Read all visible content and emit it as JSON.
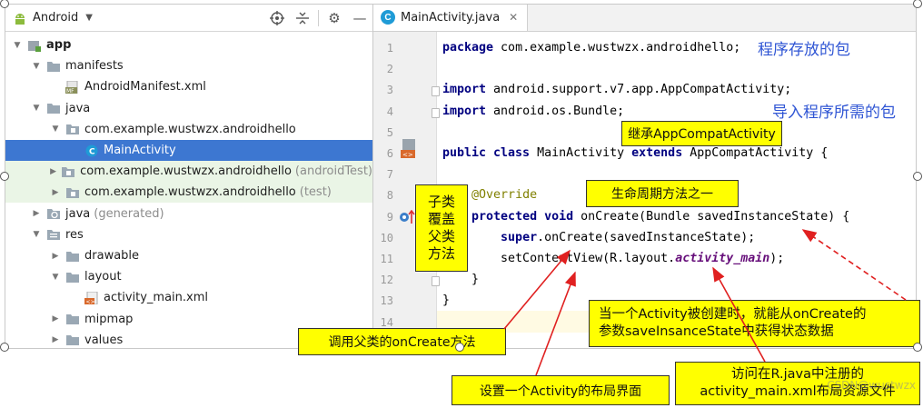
{
  "project_panel": {
    "view_mode": "Android",
    "tree": [
      {
        "label": "app",
        "indent": 0,
        "expanded": true,
        "icon": "module-icon",
        "bold": true
      },
      {
        "label": "manifests",
        "indent": 1,
        "expanded": true,
        "icon": "folder-icon"
      },
      {
        "label": "AndroidManifest.xml",
        "indent": 2,
        "icon": "manifest-file-icon"
      },
      {
        "label": "java",
        "indent": 1,
        "expanded": true,
        "icon": "folder-icon"
      },
      {
        "label": "com.example.wustwzx.androidhello",
        "indent": 2,
        "expanded": true,
        "icon": "package-icon"
      },
      {
        "label": "MainActivity",
        "indent": 3,
        "icon": "class-icon",
        "selected": true
      },
      {
        "label": "com.example.wustwzx.androidhello",
        "suffix": "(androidTest)",
        "indent": 2,
        "expanded": false,
        "icon": "package-icon",
        "test": true
      },
      {
        "label": "com.example.wustwzx.androidhello",
        "suffix": "(test)",
        "indent": 2,
        "expanded": false,
        "icon": "package-icon",
        "test": true
      },
      {
        "label": "java",
        "suffix": "(generated)",
        "indent": 1,
        "expanded": false,
        "icon": "generated-folder-icon"
      },
      {
        "label": "res",
        "indent": 1,
        "expanded": true,
        "icon": "res-folder-icon"
      },
      {
        "label": "drawable",
        "indent": 2,
        "expanded": false,
        "icon": "folder-icon"
      },
      {
        "label": "layout",
        "indent": 2,
        "expanded": true,
        "icon": "folder-icon"
      },
      {
        "label": "activity_main.xml",
        "indent": 3,
        "icon": "layout-file-icon"
      },
      {
        "label": "mipmap",
        "indent": 2,
        "expanded": false,
        "icon": "folder-icon"
      },
      {
        "label": "values",
        "indent": 2,
        "expanded": false,
        "icon": "folder-icon"
      }
    ]
  },
  "editor": {
    "tab_label": "MainActivity.java",
    "lines": [
      {
        "num": "1",
        "segs": [
          [
            "kw",
            "package"
          ],
          [
            "t",
            " com.example.wustwzx.androidhello;"
          ]
        ]
      },
      {
        "num": "2",
        "segs": []
      },
      {
        "num": "3",
        "segs": [
          [
            "kw",
            "import"
          ],
          [
            "t",
            " android.support.v7.app.AppCompatActivity;"
          ]
        ]
      },
      {
        "num": "4",
        "segs": [
          [
            "kw",
            "import"
          ],
          [
            "t",
            " android.os.Bundle;"
          ]
        ]
      },
      {
        "num": "5",
        "segs": []
      },
      {
        "num": "6",
        "segs": [
          [
            "kw",
            "public class"
          ],
          [
            "t",
            " MainActivity "
          ],
          [
            "kw",
            "extends"
          ],
          [
            "t",
            " AppCompatActivity {"
          ]
        ]
      },
      {
        "num": "7",
        "segs": []
      },
      {
        "num": "8",
        "segs": [
          [
            "t",
            "    "
          ],
          [
            "ann",
            "@Override"
          ]
        ]
      },
      {
        "num": "9",
        "segs": [
          [
            "t",
            "    "
          ],
          [
            "kw",
            "protected void"
          ],
          [
            "t",
            " onCreate(Bundle savedInstanceState) {"
          ]
        ]
      },
      {
        "num": "10",
        "segs": [
          [
            "t",
            "        "
          ],
          [
            "kw",
            "super"
          ],
          [
            "t",
            ".onCreate(savedInstanceState);"
          ]
        ]
      },
      {
        "num": "11",
        "segs": [
          [
            "t",
            "        setContentView(R.layout."
          ],
          [
            "ital",
            "activity_main"
          ],
          [
            "t",
            ");"
          ]
        ]
      },
      {
        "num": "12",
        "segs": [
          [
            "t",
            "    }"
          ]
        ]
      },
      {
        "num": "13",
        "segs": [
          [
            "t",
            "}"
          ]
        ]
      },
      {
        "num": "14",
        "segs": []
      }
    ]
  },
  "annotations": {
    "package_note": "程序存放的包",
    "import_note": "导入程序所需的包",
    "extends_note": "继承AppCompatActivity",
    "override_note": [
      "子类",
      "覆盖",
      "父类",
      "方法"
    ],
    "lifecycle_note": "生命周期方法之一",
    "super_note": "调用父类的onCreate方法",
    "layout_note": "设置一个Activity的布局界面",
    "oncreate_note": [
      "当一个Activity被创建时，就能从onCreate的",
      "参数saveInsanceState中获得状态数据"
    ],
    "rjava_note": [
      "访问在R.java中注册的",
      "activity_main.xml布局资源文件"
    ],
    "watermark": "CSDN@wustwzx"
  },
  "colors": {
    "selection": "#3d77d1",
    "test_row_bg": "#eaf5e6",
    "keyword": "#000080",
    "annotation": "#808000",
    "note_box": "#ffff00",
    "note_blue": "#2f55d4",
    "arrow_red": "#e02020"
  }
}
